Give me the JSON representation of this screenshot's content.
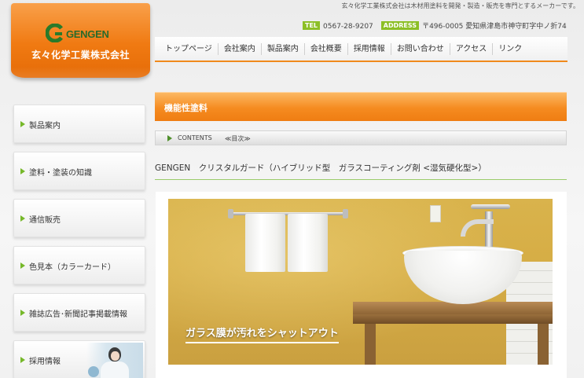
{
  "header": {
    "tagline": "玄々化学工業株式会社は木材用塗料を開発・製造・販売を専門とするメーカーです。",
    "logo": {
      "word": "GENGEN",
      "company": "玄々化学工業株式会社",
      "mark_color": "#2a7a2a"
    },
    "tel_badge": "TEL",
    "tel": "0567-28-9207",
    "address_badge": "ADDRESS",
    "address": "〒496-0005 愛知県津島市神守町字中ノ折74",
    "badge_color": "#8cbf26"
  },
  "nav": {
    "items": [
      {
        "label": "トップページ"
      },
      {
        "label": "会社案内"
      },
      {
        "label": "製品案内"
      },
      {
        "label": "会社概要"
      },
      {
        "label": "採用情報"
      },
      {
        "label": "お問い合わせ"
      },
      {
        "label": "アクセス"
      },
      {
        "label": "リンク"
      }
    ],
    "accent_color": "#f08a1c"
  },
  "sidebar": {
    "items": [
      {
        "label": "製品案内"
      },
      {
        "label": "塗料・塗装の知識"
      },
      {
        "label": "通信販売"
      },
      {
        "label": "色見本（カラーカード）"
      },
      {
        "label": "雑誌広告･新聞記事掲載情報"
      },
      {
        "label": "採用情報"
      }
    ],
    "arrow_color": "#76b82a"
  },
  "main": {
    "title": "機能性塗料",
    "breadcrumb": {
      "contents": "CONTENTS",
      "toc": "≪目次≫"
    },
    "product_title": "GENGEN　クリスタルガード（ハイブリッド型　ガラスコーティング剤 <湿気硬化型>）",
    "hero_caption": "ガラス膜が汚れをシャットアウト",
    "title_bar_color": "#f58b20"
  }
}
